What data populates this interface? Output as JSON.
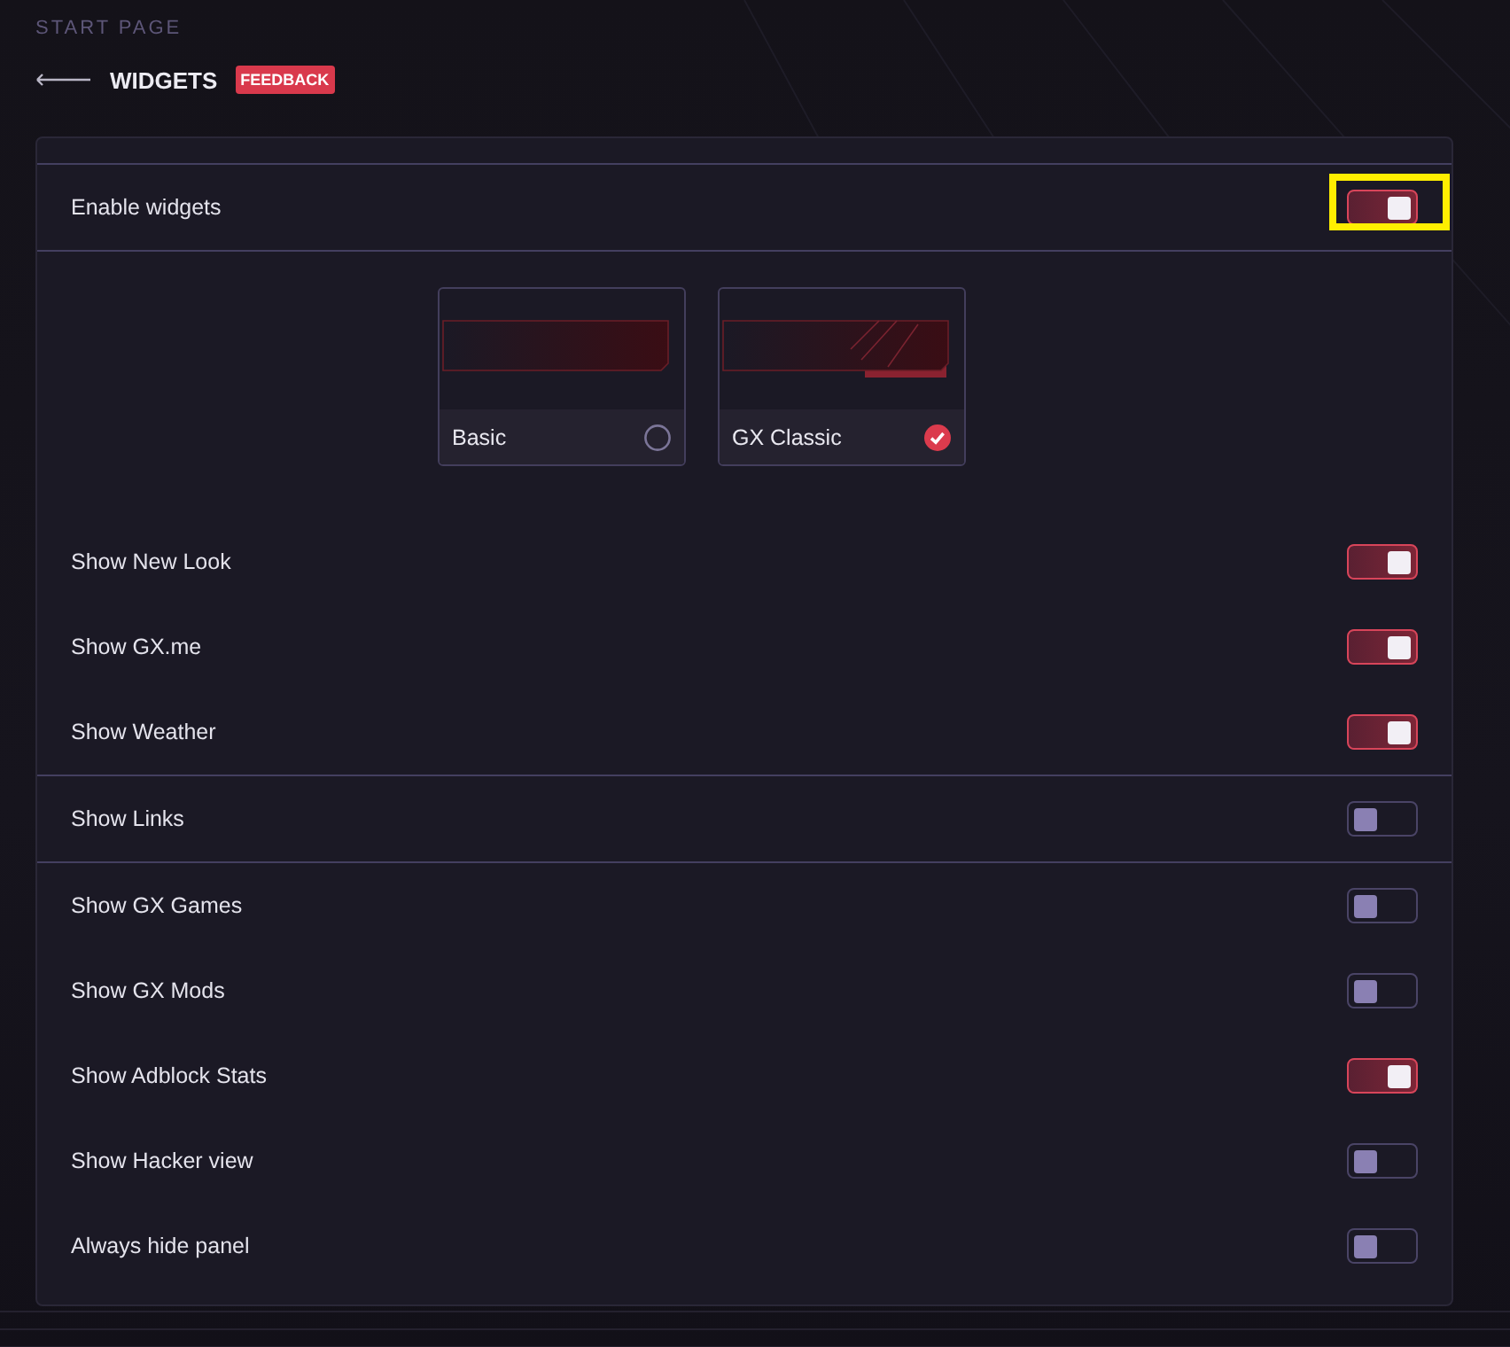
{
  "breadcrumb": "START PAGE",
  "header": {
    "title": "WIDGETS",
    "badge": "FEEDBACK"
  },
  "enable": {
    "label": "Enable widgets",
    "on": true,
    "highlighted": true
  },
  "themes": [
    {
      "label": "Basic",
      "selected": false
    },
    {
      "label": "GX Classic",
      "selected": true
    }
  ],
  "sections": [
    [
      {
        "label": "Show New Look",
        "on": true
      },
      {
        "label": "Show GX.me",
        "on": true
      },
      {
        "label": "Show Weather",
        "on": true
      }
    ],
    [
      {
        "label": "Show Links",
        "on": false
      }
    ],
    [
      {
        "label": "Show GX Games",
        "on": false
      },
      {
        "label": "Show GX Mods",
        "on": false
      },
      {
        "label": "Show Adblock Stats",
        "on": true
      },
      {
        "label": "Show Hacker view",
        "on": false
      },
      {
        "label": "Always hide panel",
        "on": false
      }
    ]
  ]
}
